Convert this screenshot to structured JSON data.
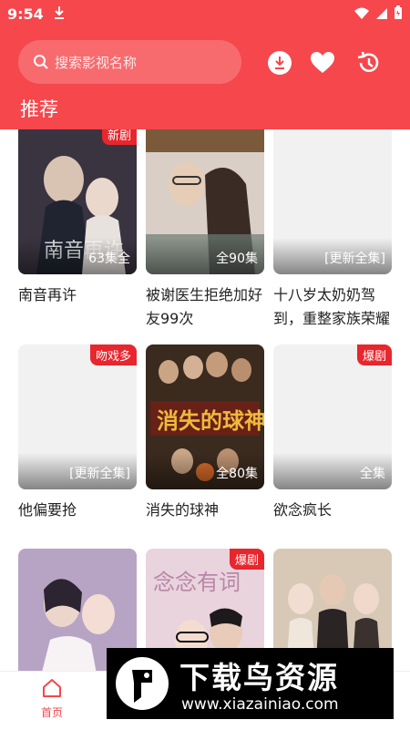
{
  "status": {
    "time": "9:54"
  },
  "search": {
    "placeholder": "搜索影视名称"
  },
  "header": {
    "tab": "推荐"
  },
  "cards": [
    {
      "title": "南音再许",
      "count": "63集全",
      "tag": "新剧",
      "bg": "#3a3440",
      "accent": "#c9b8ad"
    },
    {
      "title": "被谢医生拒绝加好友99次",
      "count": "全90集",
      "tag": "",
      "bg": "#7d6a62",
      "accent": "#d9c7bb"
    },
    {
      "title": "十八岁太奶奶驾到，重整家族荣耀",
      "count": "[更新全集]",
      "tag": "",
      "bg": "#f1f1f1",
      "accent": "#f1f1f1"
    },
    {
      "title": "他偏要抢",
      "count": "[更新全集]",
      "tag": "吻戏多",
      "bg": "#f1f1f1",
      "accent": "#f1f1f1"
    },
    {
      "title": "消失的球神",
      "count": "全80集",
      "tag": "",
      "bg": "#3b2a1e",
      "accent": "#e0a33a"
    },
    {
      "title": "欲念疯长",
      "count": "全集",
      "tag": "爆剧",
      "bg": "#f1f1f1",
      "accent": "#f1f1f1"
    },
    {
      "title": "",
      "count": "",
      "tag": "",
      "bg": "#b7a4c4",
      "accent": "#f3d6dc"
    },
    {
      "title": "",
      "count": "",
      "tag": "爆剧",
      "bg": "#e9d3dd",
      "accent": "#b887a6"
    },
    {
      "title": "",
      "count": "",
      "tag": "",
      "bg": "#d8c9b7",
      "accent": "#3a2f2a"
    }
  ],
  "nav": {
    "home": "首页"
  },
  "watermark": {
    "title": "下载鸟资源",
    "url": "www.xiazainiao.com"
  },
  "colors": {
    "brand": "#f5474c",
    "tag": "#e8262d"
  }
}
